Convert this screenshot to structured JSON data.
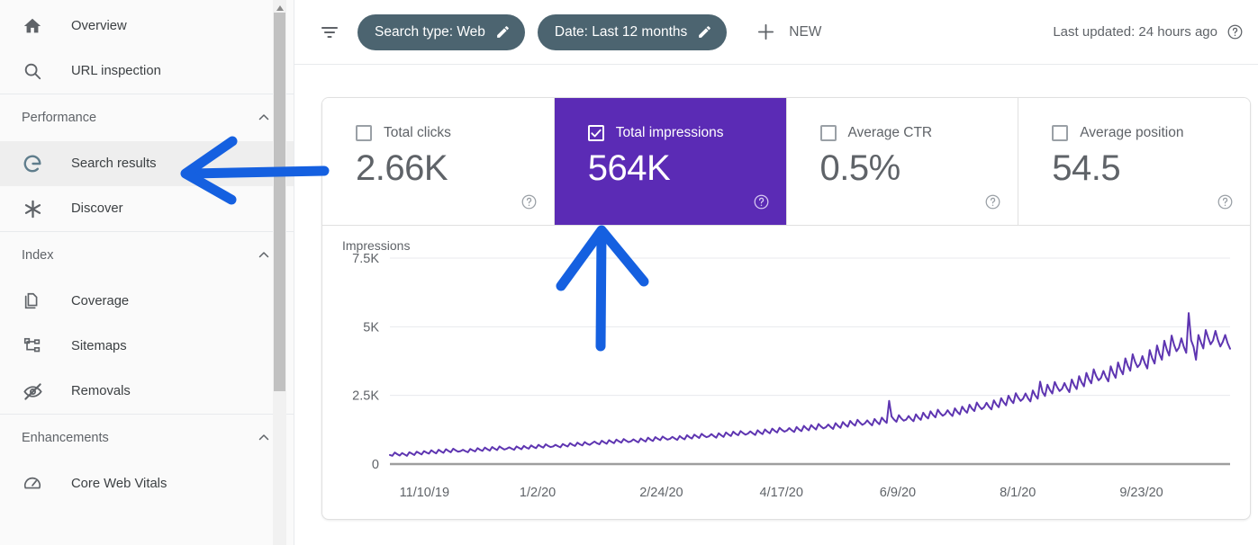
{
  "sidebar": {
    "groups": [
      {
        "header": null,
        "items": [
          {
            "label": "Overview",
            "icon": "home-icon",
            "selected": false
          },
          {
            "label": "URL inspection",
            "icon": "search-icon",
            "selected": false
          }
        ]
      },
      {
        "header": "Performance",
        "collapse_icon": "chevron-up-icon",
        "items": [
          {
            "label": "Search results",
            "icon": "google-g-icon",
            "selected": true
          },
          {
            "label": "Discover",
            "icon": "asterisk-icon",
            "selected": false
          }
        ]
      },
      {
        "header": "Index",
        "collapse_icon": "chevron-up-icon",
        "items": [
          {
            "label": "Coverage",
            "icon": "pages-icon",
            "selected": false
          },
          {
            "label": "Sitemaps",
            "icon": "sitemap-icon",
            "selected": false
          },
          {
            "label": "Removals",
            "icon": "eye-off-icon",
            "selected": false
          }
        ]
      },
      {
        "header": "Enhancements",
        "collapse_icon": "chevron-up-icon",
        "items": [
          {
            "label": "Core Web Vitals",
            "icon": "speedometer-icon",
            "selected": false
          }
        ]
      }
    ]
  },
  "toolbar": {
    "filter_icon": "filter-icon",
    "chips": [
      {
        "label": "Search type: Web",
        "edit_icon": "pencil-icon"
      },
      {
        "label": "Date: Last 12 months",
        "edit_icon": "pencil-icon"
      }
    ],
    "new_button": {
      "label": "NEW",
      "icon": "plus-icon"
    },
    "last_updated": "Last updated: 24 hours ago",
    "last_updated_help_icon": "help-circle-icon"
  },
  "metric_cards": [
    {
      "title": "Total clicks",
      "value": "2.66K",
      "checked": false,
      "help_icon": "help-circle-icon"
    },
    {
      "title": "Total impressions",
      "value": "564K",
      "checked": true,
      "help_icon": "help-circle-icon"
    },
    {
      "title": "Average CTR",
      "value": "0.5%",
      "checked": false,
      "help_icon": "help-circle-icon"
    },
    {
      "title": "Average position",
      "value": "54.5",
      "checked": false,
      "help_icon": "help-circle-icon"
    }
  ],
  "colors": {
    "accent_purple": "#5b2bb5",
    "line_purple": "#5e35b1",
    "chip_slate": "#4c6470",
    "annotation_blue": "#1560e0",
    "text_gray": "#5f6368"
  },
  "annotations": [
    {
      "name": "arrow-to-search-results",
      "direction": "left",
      "color": "#1560e0"
    },
    {
      "name": "arrow-to-total-impressions",
      "direction": "up",
      "color": "#1560e0"
    }
  ],
  "chart_data": {
    "type": "line",
    "title": "Impressions",
    "xlabel": "",
    "ylabel": "Impressions",
    "ylim": [
      0,
      7500
    ],
    "yticks": [
      0,
      2500,
      5000,
      7500
    ],
    "ytick_labels": [
      "0",
      "2.5K",
      "5K",
      "7.5K"
    ],
    "grid": true,
    "legend": "none",
    "series_color": "#5e35b1",
    "xtick_labels": [
      "11/10/19",
      "1/2/20",
      "2/24/20",
      "4/17/20",
      "6/9/20",
      "8/1/20",
      "9/23/20"
    ],
    "x_start": "11/10/19",
    "x_end": "10/30/20",
    "series": [
      {
        "name": "Impressions",
        "values": [
          330,
          300,
          420,
          360,
          310,
          400,
          350,
          300,
          430,
          380,
          330,
          450,
          400,
          350,
          470,
          420,
          380,
          500,
          440,
          390,
          520,
          460,
          410,
          540,
          480,
          430,
          560,
          500,
          450,
          470,
          520,
          470,
          430,
          550,
          500,
          460,
          580,
          520,
          480,
          600,
          540,
          490,
          620,
          560,
          510,
          640,
          580,
          530,
          560,
          610,
          560,
          520,
          640,
          590,
          540,
          660,
          600,
          560,
          680,
          620,
          580,
          700,
          640,
          600,
          720,
          660,
          620,
          640,
          700,
          650,
          610,
          730,
          680,
          640,
          760,
          700,
          660,
          780,
          720,
          680,
          800,
          740,
          700,
          760,
          820,
          760,
          720,
          850,
          790,
          740,
          870,
          810,
          760,
          890,
          830,
          780,
          910,
          850,
          800,
          830,
          900,
          840,
          790,
          930,
          870,
          820,
          960,
          890,
          840,
          980,
          920,
          870,
          1000,
          940,
          890,
          920,
          990,
          930,
          880,
          1020,
          950,
          900,
          1050,
          980,
          930,
          1070,
          1010,
          950,
          1100,
          1030,
          980,
          1010,
          1090,
          1020,
          960,
          1120,
          1050,
          990,
          1150,
          1080,
          1020,
          1180,
          1100,
          1050,
          1200,
          1130,
          1070,
          1110,
          1190,
          1120,
          1060,
          1230,
          1150,
          1090,
          1260,
          1180,
          1120,
          1290,
          1210,
          1150,
          1320,
          1240,
          1180,
          1220,
          1310,
          1230,
          1170,
          1350,
          1260,
          1200,
          1390,
          1300,
          1230,
          1420,
          1330,
          1260,
          1460,
          1370,
          1300,
          1340,
          1440,
          1350,
          1280,
          1490,
          1390,
          1320,
          1530,
          1430,
          1360,
          1570,
          1470,
          1400,
          1610,
          1510,
          1430,
          1480,
          1590,
          1490,
          1410,
          1640,
          1530,
          1450,
          1690,
          1580,
          1500,
          2300,
          1730,
          1620,
          1540,
          1780,
          1660,
          1580,
          1620,
          1750,
          1640,
          1560,
          1810,
          1690,
          1610,
          1870,
          1740,
          1660,
          1920,
          1790,
          1700,
          1980,
          1850,
          1760,
          1820,
          1960,
          1840,
          1750,
          2030,
          1900,
          1810,
          2090,
          1960,
          1870,
          2160,
          2020,
          1930,
          2240,
          2100,
          2000,
          2070,
          2230,
          2090,
          1990,
          2320,
          2170,
          2070,
          2400,
          2250,
          2140,
          2490,
          2330,
          2220,
          2580,
          2420,
          2300,
          2380,
          2570,
          2400,
          2280,
          2680,
          2500,
          2380,
          3000,
          2620,
          2480,
          2890,
          2700,
          2570,
          2990,
          2800,
          2660,
          2740,
          2950,
          2760,
          2620,
          3080,
          2870,
          2730,
          3200,
          2980,
          2830,
          3320,
          3090,
          2940,
          3450,
          3210,
          3050,
          3140,
          3390,
          3170,
          3010,
          3560,
          3310,
          3140,
          3700,
          3440,
          3270,
          3850,
          3580,
          3400,
          4000,
          3720,
          3530,
          3640,
          3930,
          3670,
          3480,
          4150,
          3860,
          3660,
          4320,
          4010,
          3800,
          4490,
          4170,
          3950,
          4680,
          4340,
          4110,
          4240,
          4580,
          4270,
          4050,
          5500,
          4510,
          4270,
          3800,
          4700,
          4440,
          4210,
          4880,
          4600,
          4360,
          4500,
          4850,
          4520,
          4280,
          4450,
          4700,
          4400,
          4200
        ]
      }
    ]
  }
}
